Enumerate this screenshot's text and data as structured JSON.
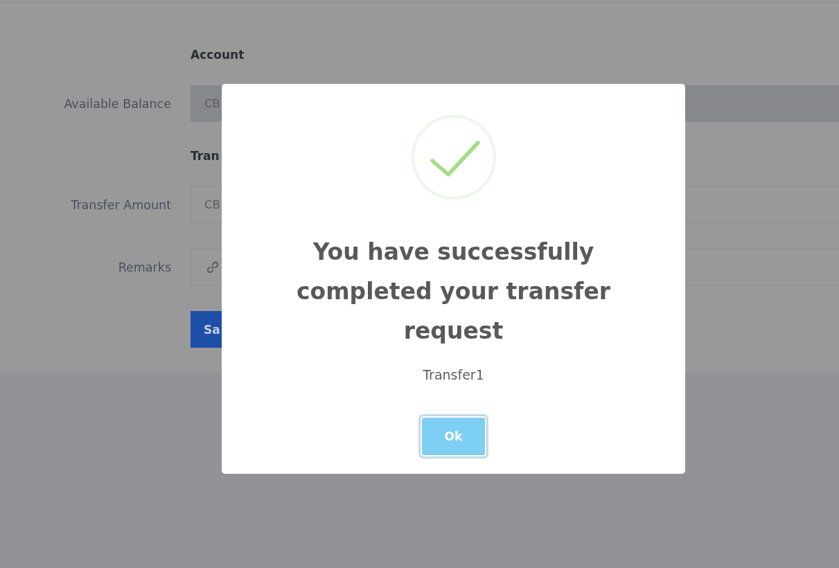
{
  "form": {
    "sections": [
      {
        "heading": "Account",
        "fields": [
          {
            "label": "Available Balance",
            "kind": "text",
            "value": "CB",
            "disabled": true
          }
        ]
      },
      {
        "heading": "Tran",
        "fields": [
          {
            "label": "Transfer Amount",
            "kind": "text",
            "value": "CB",
            "disabled": false
          },
          {
            "label": "Remarks",
            "kind": "icon",
            "disabled": false
          }
        ]
      }
    ],
    "submit_button": "Sa"
  },
  "dialog": {
    "title": "You have successfully completed your transfer request",
    "message": "Transfer1",
    "confirm_button": {
      "label": "Ok",
      "focused": true
    }
  }
}
